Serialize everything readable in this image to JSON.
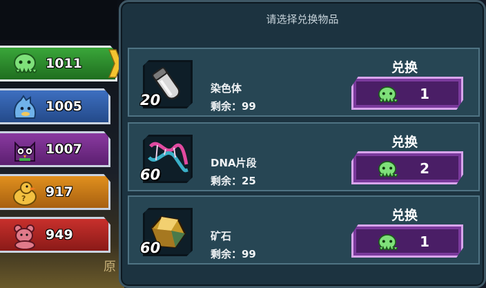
{
  "panel": {
    "title": "请选择兑换物品"
  },
  "currencies": [
    {
      "name": "green-octopus",
      "count": "1011",
      "color": "#2f8f2f"
    },
    {
      "name": "blue-creature",
      "count": "1005",
      "color": "#3562ae"
    },
    {
      "name": "owl",
      "count": "1007",
      "color": "#7a2f92"
    },
    {
      "name": "duck",
      "count": "917",
      "color": "#cc8016"
    },
    {
      "name": "bear",
      "count": "949",
      "color": "#b2281f"
    }
  ],
  "items": [
    {
      "qty": "20",
      "name": "染色体",
      "remaining_label": "剩余：99",
      "exchange_label": "兑换",
      "cost": "1",
      "icon": "test-tube-icon"
    },
    {
      "qty": "60",
      "name": "DNA片段",
      "remaining_label": "剩余：25",
      "exchange_label": "兑换",
      "cost": "2",
      "icon": "dna-icon"
    },
    {
      "qty": "60",
      "name": "矿石",
      "remaining_label": "剩余：99",
      "exchange_label": "兑换",
      "cost": "1",
      "icon": "ore-icon"
    }
  ],
  "bottom_glyph": "原",
  "colors": {
    "panel_bg": "#1c3340",
    "row_bg": "#274654",
    "button_purple": "#7a3a9c"
  }
}
